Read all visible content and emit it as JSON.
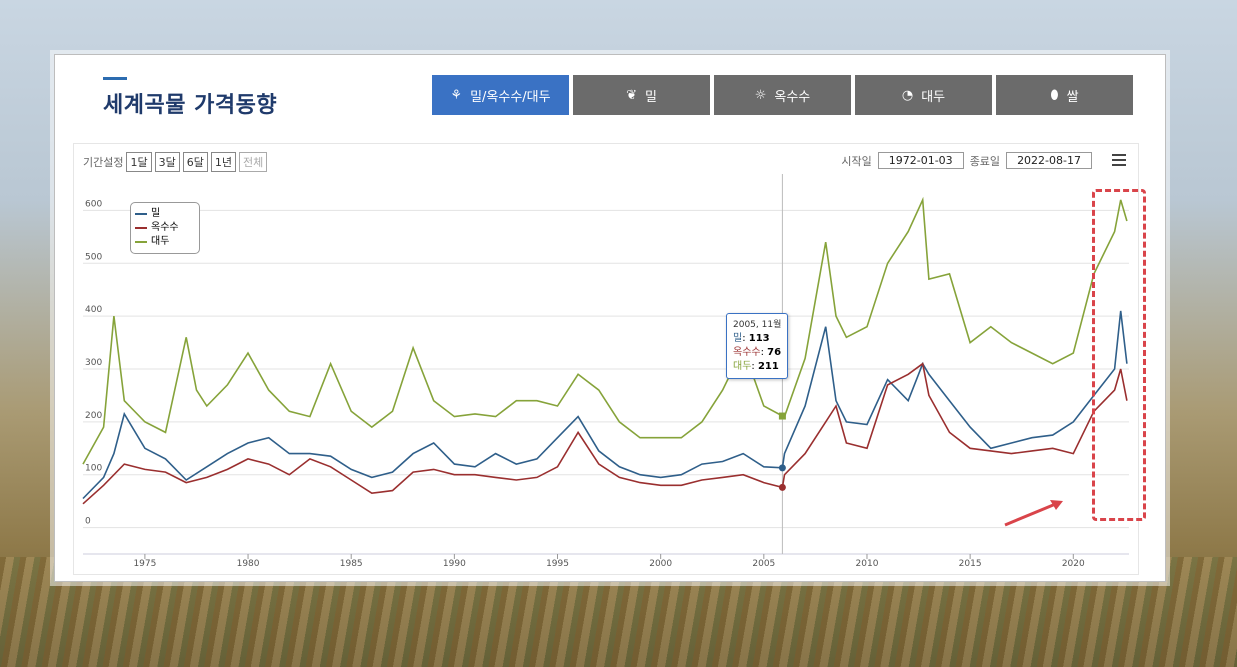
{
  "header": {
    "title": "세계곡물 가격동향"
  },
  "tabs": [
    {
      "label": "밀/옥수수/대두",
      "icon": "wheat-icon",
      "active": true
    },
    {
      "label": "밀",
      "icon": "grain-icon",
      "active": false
    },
    {
      "label": "옥수수",
      "icon": "corn-icon",
      "active": false
    },
    {
      "label": "대두",
      "icon": "bean-icon",
      "active": false
    },
    {
      "label": "쌀",
      "icon": "rice-icon",
      "active": false
    }
  ],
  "range": {
    "label": "기간설정",
    "buttons": [
      "1달",
      "3달",
      "6달",
      "1년",
      "전체"
    ],
    "start_label": "시작일",
    "start_value": "1972-01-03",
    "end_label": "종료일",
    "end_value": "2022-08-17"
  },
  "tooltip": {
    "header": "2005, 11월",
    "rows": [
      {
        "name": "밀",
        "value": "113"
      },
      {
        "name": "옥수수",
        "value": "76"
      },
      {
        "name": "대두",
        "value": "211"
      }
    ]
  },
  "colors": {
    "wheat": "#2f5f8a",
    "corn": "#9a2f2f",
    "soybean": "#86a33a",
    "accent": "#3a72c4",
    "highlight": "#d9444a"
  },
  "chart_data": {
    "type": "line",
    "xlim": [
      1972,
      2022.7
    ],
    "ylim": [
      -50,
      650
    ],
    "yticks": [
      0,
      100,
      200,
      300,
      400,
      500,
      600
    ],
    "xticks": [
      1975,
      1980,
      1985,
      1990,
      1995,
      2000,
      2005,
      2010,
      2015,
      2020
    ],
    "legend": "top-left",
    "series": [
      {
        "name": "밀",
        "x": [
          1972,
          1973,
          1973.5,
          1974,
          1975,
          1976,
          1977,
          1978,
          1979,
          1980,
          1981,
          1982,
          1983,
          1984,
          1985,
          1986,
          1987,
          1988,
          1989,
          1990,
          1991,
          1992,
          1993,
          1994,
          1995,
          1996,
          1997,
          1998,
          1999,
          2000,
          2001,
          2002,
          2003,
          2004,
          2005,
          2005.9,
          2006,
          2007,
          2008,
          2008.5,
          2009,
          2010,
          2011,
          2012,
          2012.7,
          2013,
          2014,
          2015,
          2016,
          2017,
          2018,
          2019,
          2020,
          2021,
          2022,
          2022.3,
          2022.6
        ],
        "y": [
          55,
          95,
          140,
          215,
          150,
          130,
          90,
          115,
          140,
          160,
          170,
          140,
          140,
          135,
          110,
          95,
          105,
          140,
          160,
          120,
          115,
          140,
          120,
          130,
          170,
          210,
          145,
          115,
          100,
          95,
          100,
          120,
          125,
          140,
          115,
          113,
          140,
          230,
          380,
          240,
          200,
          195,
          280,
          240,
          310,
          290,
          240,
          190,
          150,
          160,
          170,
          175,
          200,
          250,
          300,
          410,
          310
        ]
      },
      {
        "name": "옥수수",
        "x": [
          1972,
          1973,
          1974,
          1975,
          1976,
          1977,
          1978,
          1979,
          1980,
          1981,
          1982,
          1983,
          1984,
          1985,
          1986,
          1987,
          1988,
          1989,
          1990,
          1991,
          1992,
          1993,
          1994,
          1995,
          1996,
          1997,
          1998,
          1999,
          2000,
          2001,
          2002,
          2003,
          2004,
          2005,
          2005.9,
          2006,
          2007,
          2008,
          2008.5,
          2009,
          2010,
          2011,
          2012,
          2012.7,
          2013,
          2014,
          2015,
          2016,
          2017,
          2018,
          2019,
          2020,
          2021,
          2022,
          2022.3,
          2022.6
        ],
        "y": [
          45,
          80,
          120,
          110,
          105,
          85,
          95,
          110,
          130,
          120,
          100,
          130,
          115,
          90,
          65,
          70,
          105,
          110,
          100,
          100,
          95,
          90,
          95,
          115,
          180,
          120,
          95,
          85,
          80,
          80,
          90,
          95,
          100,
          85,
          76,
          100,
          140,
          200,
          230,
          160,
          150,
          270,
          290,
          310,
          250,
          180,
          150,
          145,
          140,
          145,
          150,
          140,
          220,
          260,
          300,
          240
        ]
      },
      {
        "name": "대두",
        "x": [
          1972,
          1973,
          1973.5,
          1974,
          1975,
          1976,
          1977,
          1977.5,
          1978,
          1979,
          1980,
          1981,
          1982,
          1983,
          1984,
          1985,
          1986,
          1987,
          1988,
          1989,
          1990,
          1991,
          1992,
          1993,
          1994,
          1995,
          1996,
          1997,
          1998,
          1999,
          2000,
          2001,
          2002,
          2003,
          2004,
          2005,
          2005.9,
          2006,
          2007,
          2008,
          2008.5,
          2009,
          2010,
          2011,
          2012,
          2012.7,
          2013,
          2014,
          2015,
          2016,
          2017,
          2018,
          2019,
          2020,
          2021,
          2022,
          2022.3,
          2022.6
        ],
        "y": [
          120,
          190,
          400,
          240,
          200,
          180,
          360,
          260,
          230,
          270,
          330,
          260,
          220,
          210,
          310,
          220,
          190,
          220,
          340,
          240,
          210,
          215,
          210,
          240,
          240,
          230,
          290,
          260,
          200,
          170,
          170,
          170,
          200,
          260,
          340,
          230,
          211,
          210,
          320,
          540,
          400,
          360,
          380,
          500,
          560,
          620,
          470,
          480,
          350,
          380,
          350,
          330,
          310,
          330,
          480,
          560,
          620,
          580
        ]
      }
    ]
  }
}
